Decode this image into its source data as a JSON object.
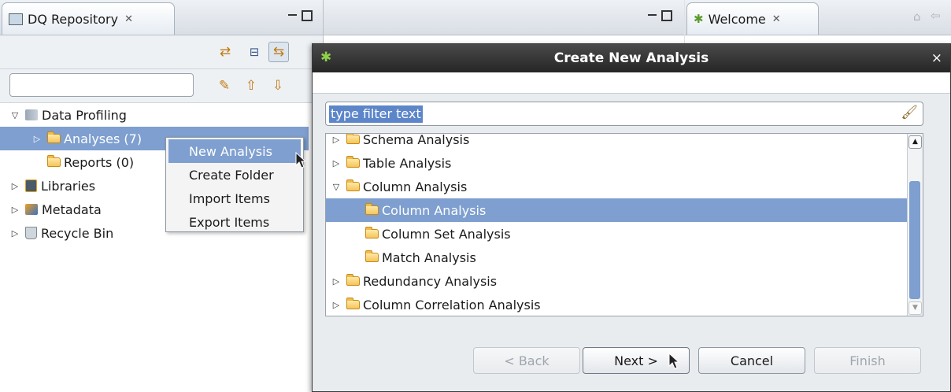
{
  "left_view": {
    "tab_title": "DQ Repository",
    "tab_close": "✕",
    "toolbar_icons": [
      "sync-icon",
      "collapse-all-icon",
      "link-editor-icon"
    ],
    "filter_icons": [
      "pen-icon",
      "arrow-up-icon",
      "arrow-down-icon"
    ],
    "search": {
      "value": "",
      "placeholder": ""
    },
    "tree": [
      {
        "label": "Data Profiling",
        "expanded": true
      },
      {
        "label": "Analyses (7)",
        "selected": true
      },
      {
        "label": "Reports (0)"
      },
      {
        "label": "Libraries"
      },
      {
        "label": "Metadata"
      },
      {
        "label": "Recycle Bin"
      }
    ]
  },
  "context_menu": {
    "items": [
      "New Analysis",
      "Create Folder",
      "Import Items",
      "Export Items"
    ]
  },
  "right_view": {
    "tab_title": "Welcome",
    "tab_close": "✕"
  },
  "dialog": {
    "title": "Create New Analysis",
    "close": "×",
    "filter": {
      "value": "type filter text"
    },
    "tree": [
      {
        "label": "Schema Analysis",
        "level": 0,
        "expanded": false
      },
      {
        "label": "Table Analysis",
        "level": 0,
        "expanded": false
      },
      {
        "label": "Column Analysis",
        "level": 0,
        "expanded": true
      },
      {
        "label": "Column Analysis",
        "level": 1,
        "selected": true
      },
      {
        "label": "Column Set Analysis",
        "level": 1
      },
      {
        "label": "Match Analysis",
        "level": 1
      },
      {
        "label": "Redundancy Analysis",
        "level": 0,
        "expanded": false
      },
      {
        "label": "Column Correlation Analysis",
        "level": 0,
        "expanded": false
      }
    ],
    "buttons": {
      "back": "< Back",
      "next": "Next >",
      "cancel": "Cancel",
      "finish": "Finish"
    }
  },
  "colors": {
    "selection": "#7e9fcf",
    "title_bar": "#2f2f2f",
    "folder": "#f5c45a"
  }
}
